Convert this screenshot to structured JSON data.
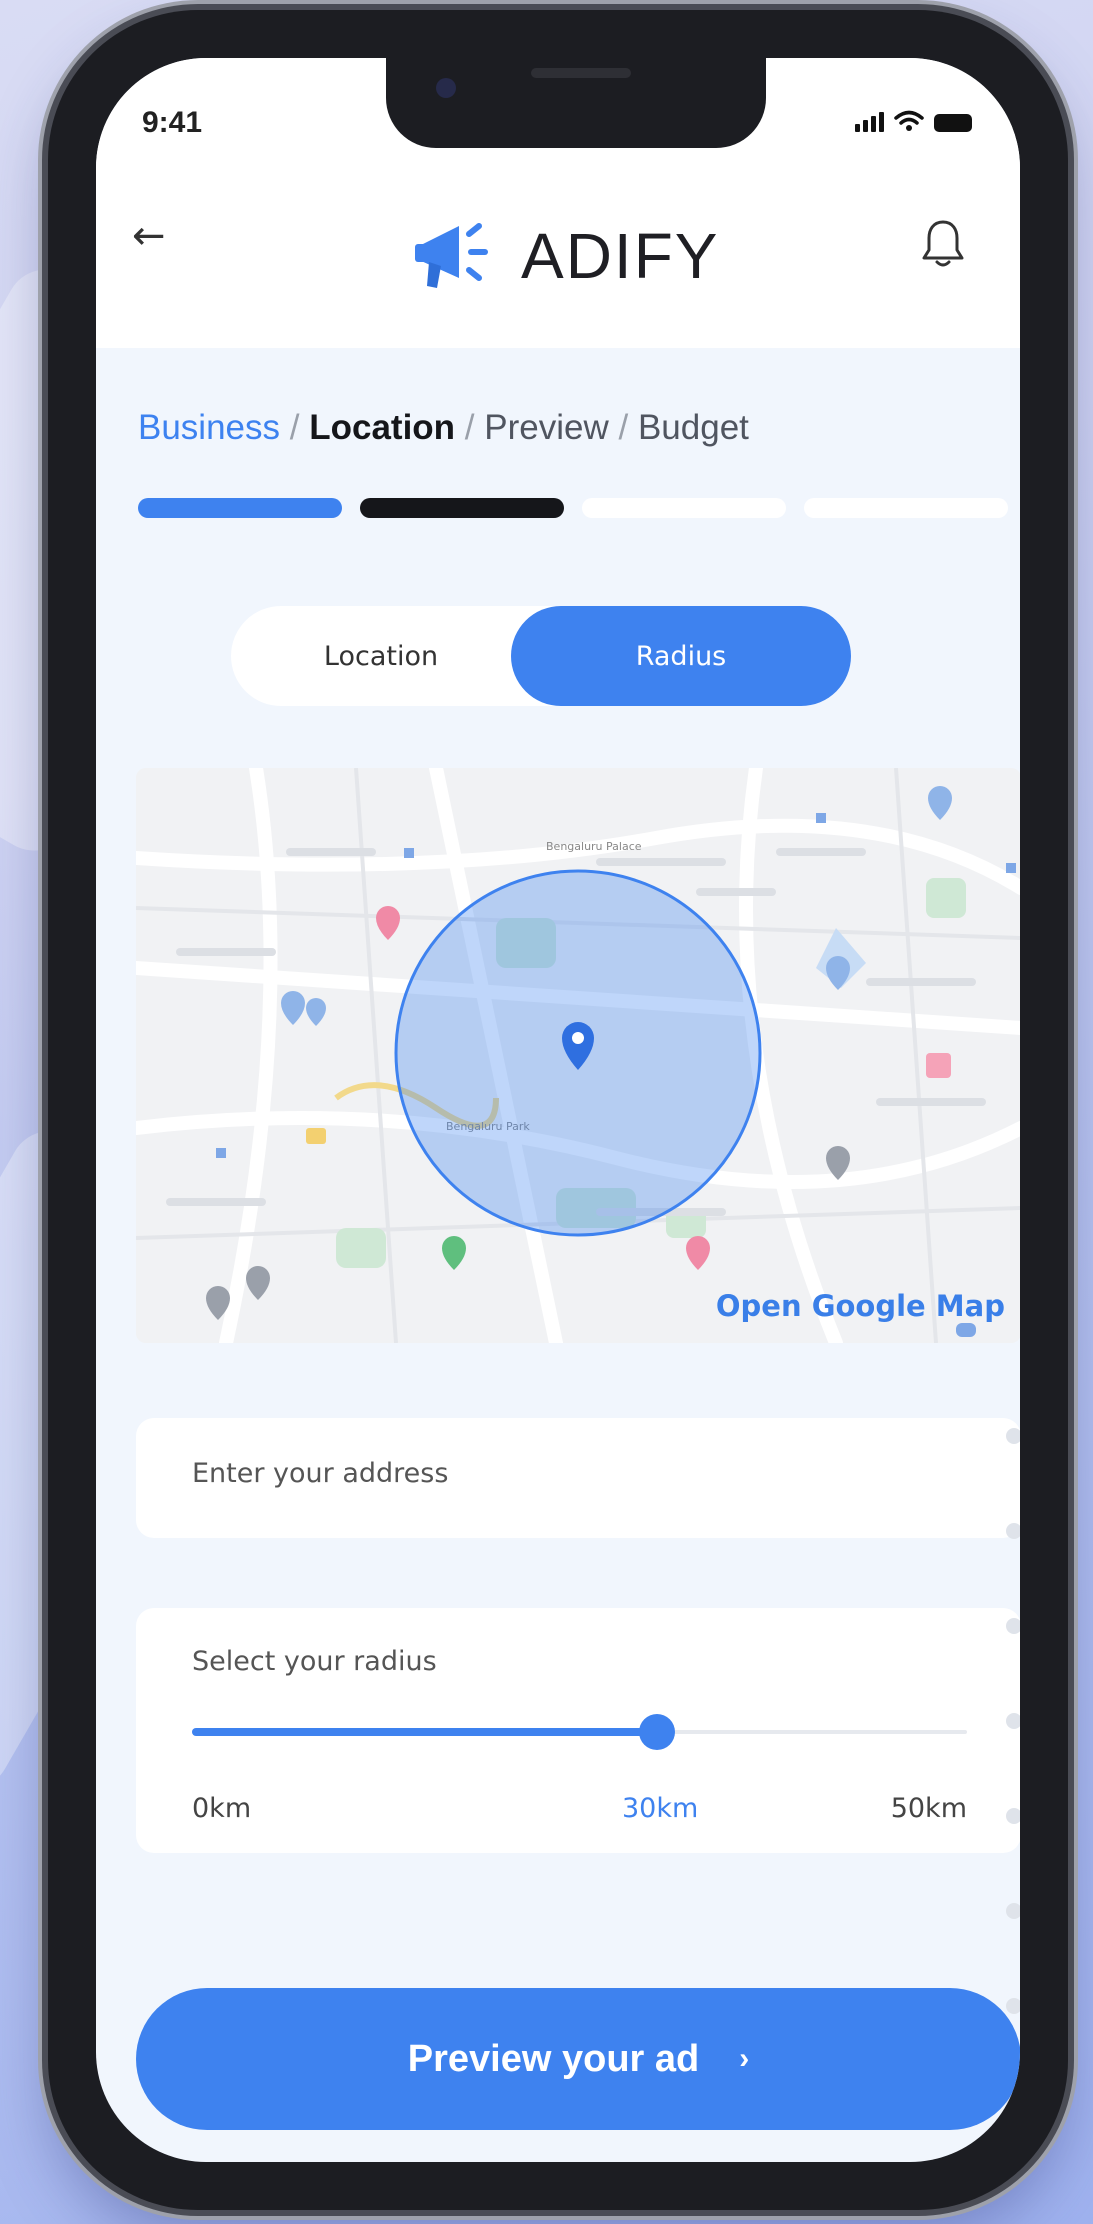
{
  "status_bar": {
    "time": "9:41"
  },
  "header": {
    "brand": "ADIFY"
  },
  "breadcrumb": {
    "steps": [
      "Business",
      "Location",
      "Preview",
      "Budget"
    ],
    "separator": "/",
    "current": "Location"
  },
  "progress": {
    "steps_total": 4,
    "steps_done": 2
  },
  "mode_toggle": {
    "location": "Location",
    "radius": "Radius",
    "selected": "Radius"
  },
  "map": {
    "link": "Open Google Map",
    "label_location": "Bengaluru Palace",
    "label_park": "Bengaluru Park"
  },
  "address": {
    "placeholder": "Enter your address"
  },
  "radius_slider": {
    "label": "Select your radius",
    "min_label": "0km",
    "value_label": "30km",
    "max_label": "50km",
    "min": 0,
    "max": 50,
    "value": 30
  },
  "cta": {
    "label": "Preview your ad",
    "chevron": "›"
  },
  "colors": {
    "primary": "#3e82ef",
    "dark": "#15161a",
    "screen_bg": "#f1f6fd",
    "track": "#e6e9ee"
  }
}
